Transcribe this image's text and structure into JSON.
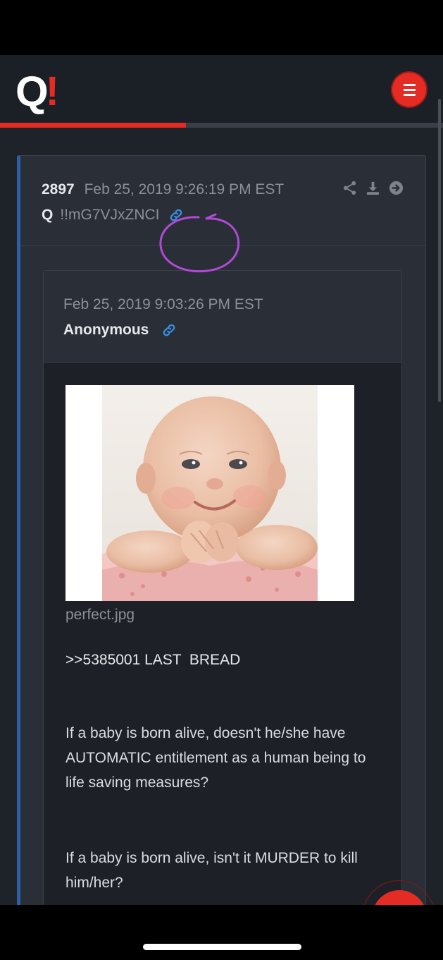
{
  "header": {
    "logo_q": "Q",
    "logo_bang": "!",
    "menu_icon": "hamburger-menu-icon",
    "progress_percent": 42
  },
  "post": {
    "number": "2897",
    "date": "Feb 25, 2019 9:26:19 PM EST",
    "author": "Q",
    "tripcode": "!!mG7VJxZNCI",
    "icons": [
      "share-icon",
      "download-icon",
      "arrow-right-circle-icon",
      "link-icon"
    ]
  },
  "quote": {
    "date": "Feb 25, 2019 9:03:26 PM EST",
    "author": "Anonymous",
    "image_filename": "perfect.jpg",
    "reply_ref": ">>5385001 LAST  BREAD",
    "paragraphs": [
      "If a baby is born alive, doesn't he/she have AUTOMATIC entitlement as a human being to life saving measures?",
      "If a baby is born alive, isn't it MURDER to kill him/her?"
    ]
  },
  "fab": {
    "icon": "bell-icon"
  },
  "colors": {
    "accent_red": "#e42b24",
    "post_border_blue": "#2d5fa8",
    "link_blue": "#3a8be0",
    "annotation_purple": "#b04ad6"
  }
}
